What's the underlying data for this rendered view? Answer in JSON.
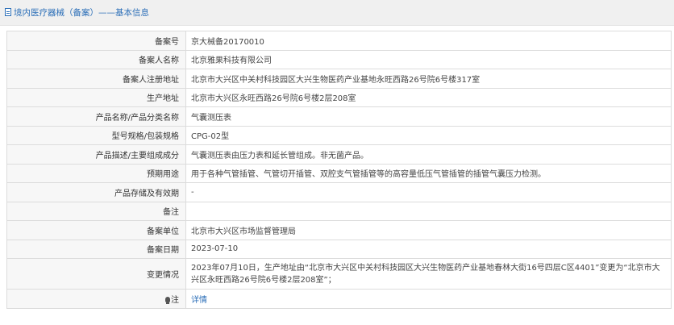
{
  "header": {
    "title": "境内医疗器械（备案）——基本信息",
    "icon": "document-icon"
  },
  "rows": [
    {
      "label": "备案号",
      "value": "京大械备20170010"
    },
    {
      "label": "备案人名称",
      "value": "北京雅果科技有限公司"
    },
    {
      "label": "备案人注册地址",
      "value": "北京市大兴区中关村科技园区大兴生物医药产业基地永旺西路26号院6号楼317室"
    },
    {
      "label": "生产地址",
      "value": "北京市大兴区永旺西路26号院6号楼2层208室"
    },
    {
      "label": "产品名称/产品分类名称",
      "value": "气囊测压表"
    },
    {
      "label": "型号规格/包装规格",
      "value": "CPG-02型"
    },
    {
      "label": "产品描述/主要组成成分",
      "value": "气囊测压表由压力表和延长管组成。非无菌产品。"
    },
    {
      "label": "预期用途",
      "value": "用于各种气管插管、气管切开插管、双腔支气管插管等的高容量低压气管插管的插管气囊压力检测。"
    },
    {
      "label": "产品存储及有效期",
      "value": "-"
    },
    {
      "label": "备注",
      "value": ""
    },
    {
      "label": "备案单位",
      "value": "北京市大兴区市场监督管理局"
    },
    {
      "label": "备案日期",
      "value": "2023-07-10"
    },
    {
      "label": "变更情况",
      "value": "2023年07月10日，生产地址由“北京市大兴区中关村科技园区大兴生物医药产业基地春林大街16号四层C区4401”变更为“北京市大兴区永旺西路26号院6号楼2层208室”；"
    }
  ],
  "note": {
    "label": "注",
    "icon": "lightbulb-icon",
    "link_text": "详情"
  },
  "colors": {
    "accent": "#2c6fb8",
    "label_bg": "#f7f7f7",
    "border": "#dcdcdc"
  }
}
